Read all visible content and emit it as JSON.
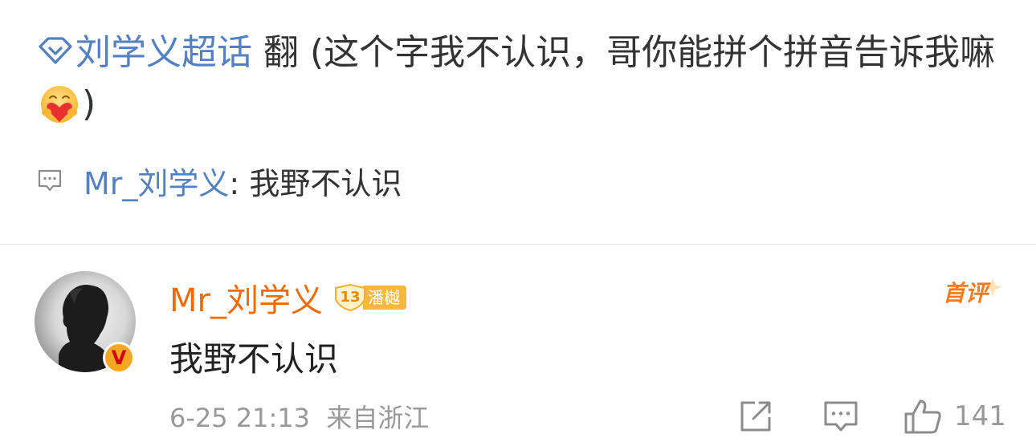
{
  "post": {
    "topic": "刘学义超话",
    "text": " 翻 (这个字我不认识，哥你能拼个拼音告诉我嘛",
    "text_after_emoji": ")",
    "emoji": "hug-heart-emoji"
  },
  "reply_preview": {
    "author": "Mr_刘学义",
    "separator": ": ",
    "text": "我野不认识"
  },
  "comment": {
    "username": "Mr_刘学义",
    "fan_level": "13",
    "fan_group": "潘樾",
    "first_tag": "首评",
    "text": "我野不认识",
    "date": "6-25",
    "time": "21:13",
    "location": "来自浙江",
    "like_count": "141",
    "verified_badge": "V"
  },
  "colors": {
    "link_blue": "#5280c0",
    "username_orange": "#f46a00",
    "meta_gray": "#999999"
  }
}
